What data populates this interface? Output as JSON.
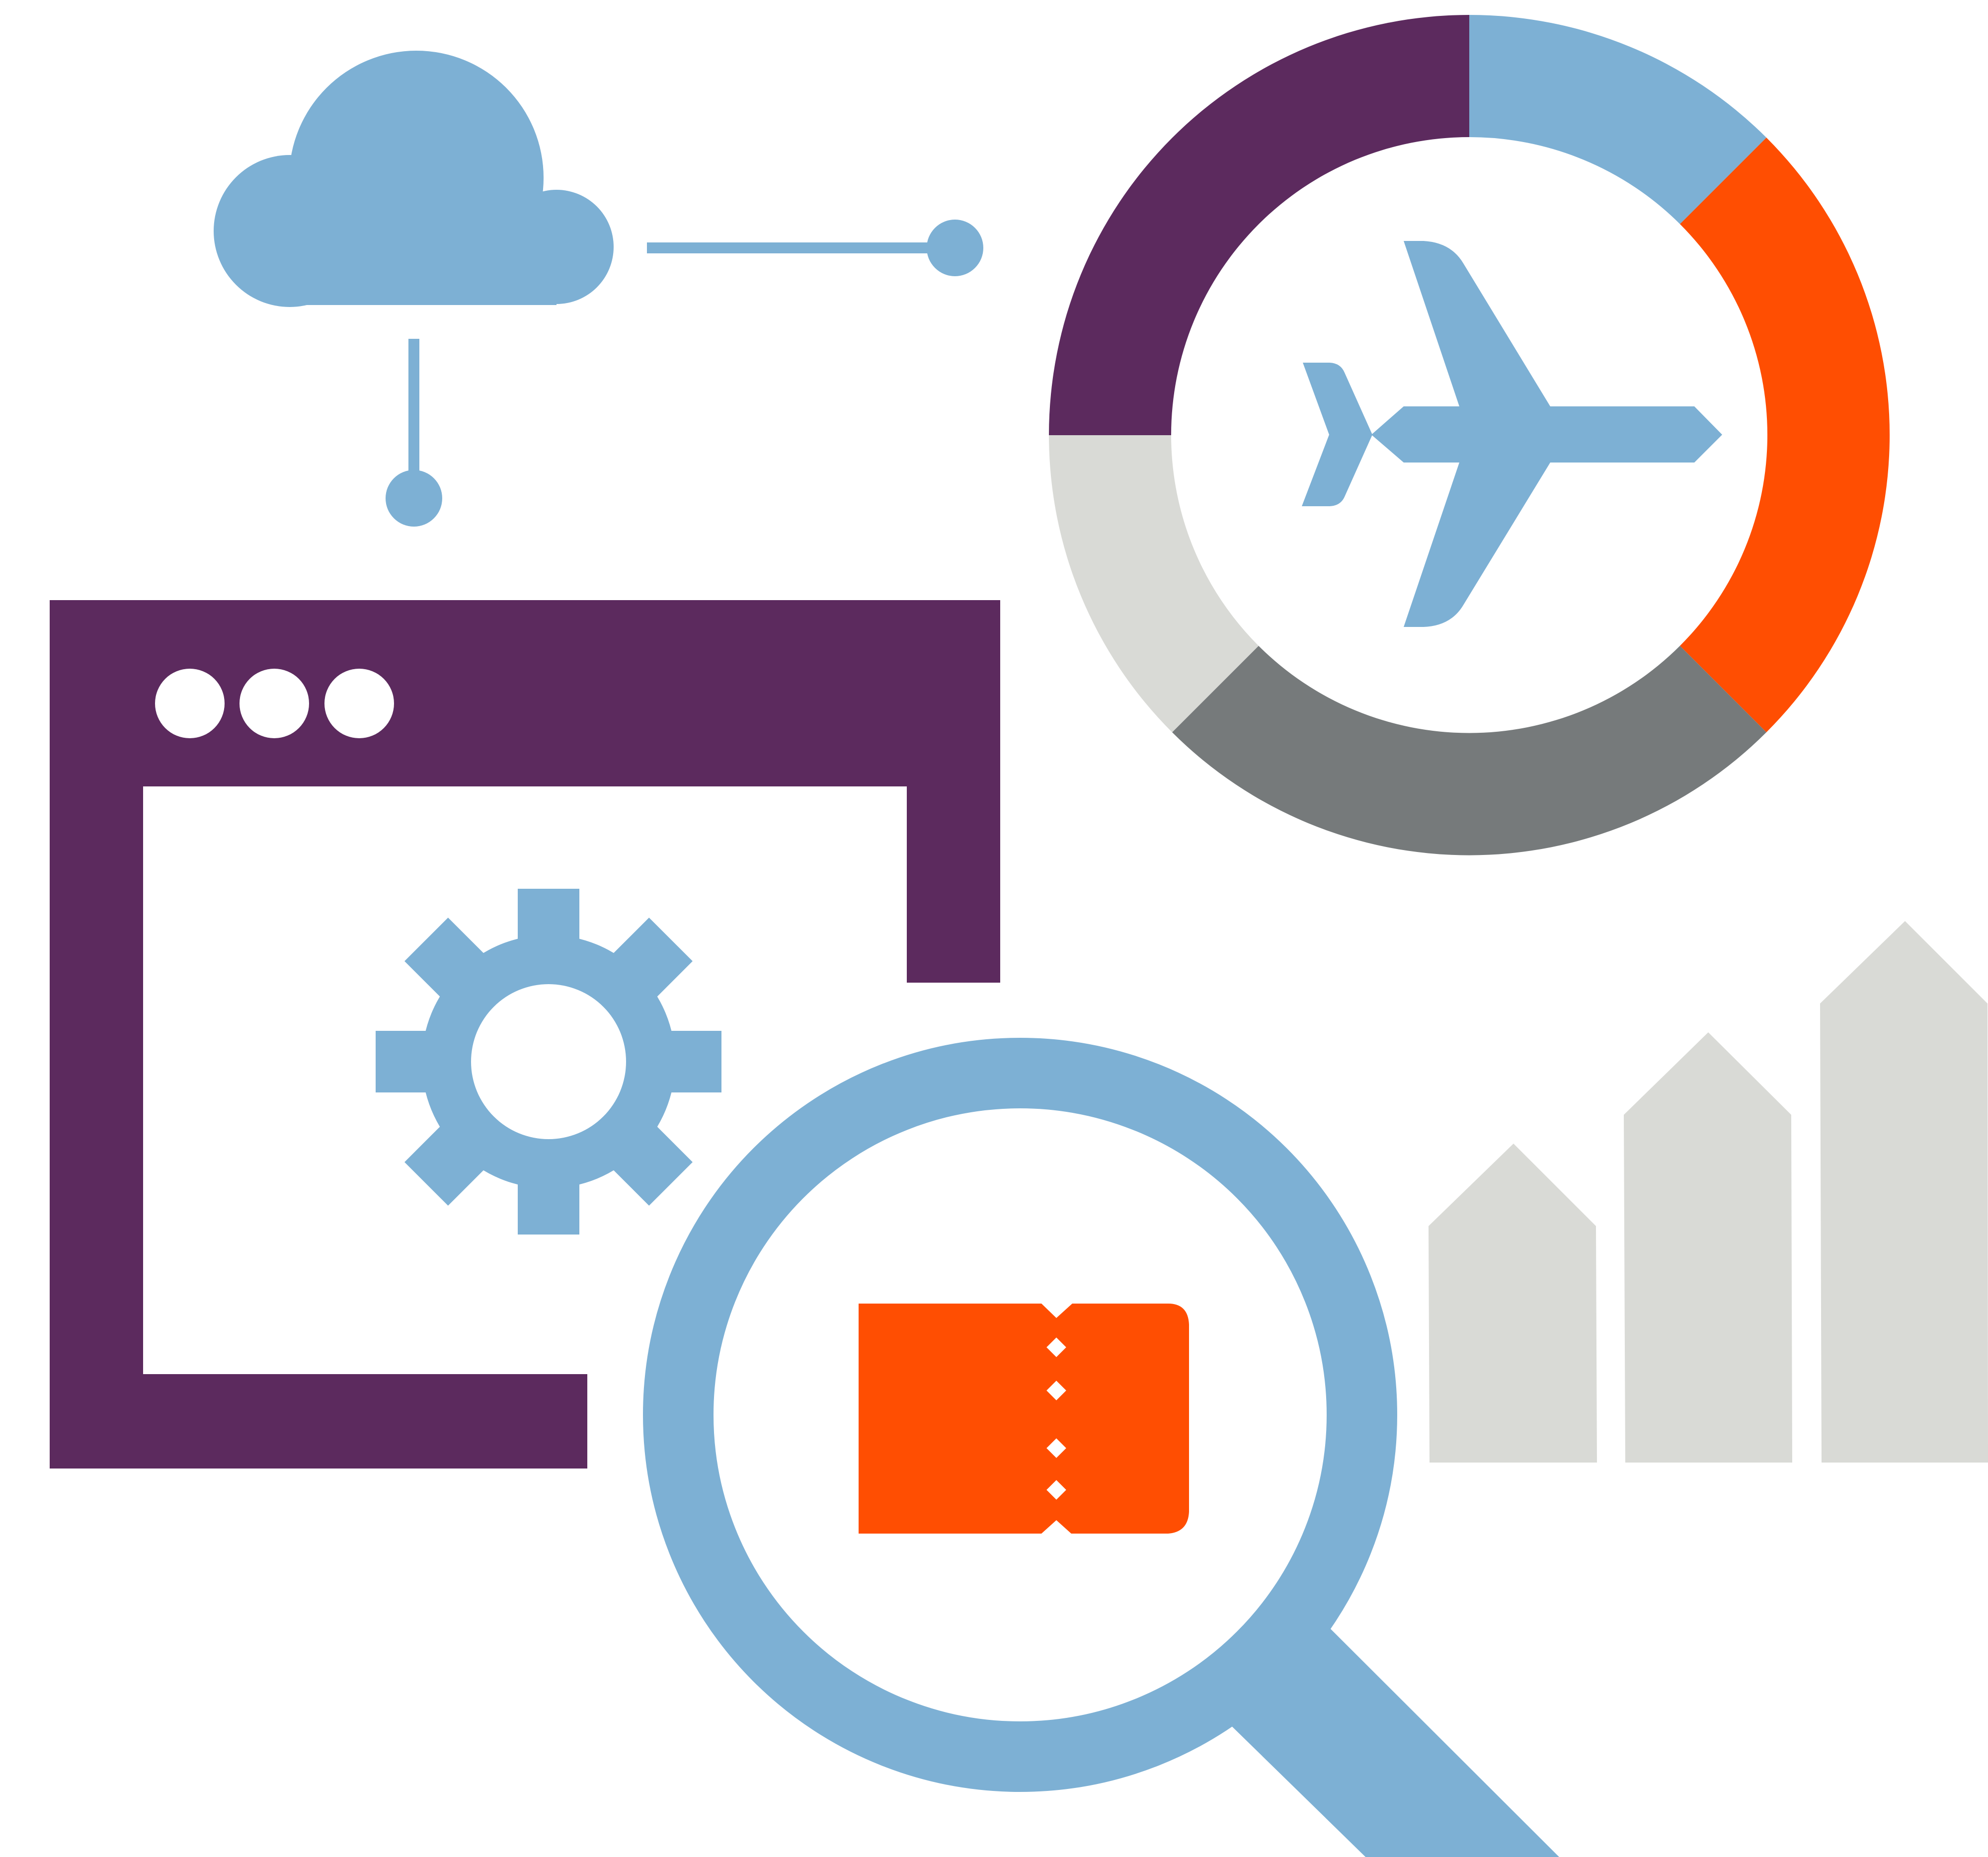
{
  "colors": {
    "blue": "#7db0d4",
    "purple": "#5c2a5e",
    "orange": "#ff4e02",
    "light_gray": "#d9dad6",
    "dark_gray": "#767a7b",
    "white": "#ffffff"
  },
  "icons": {
    "cloud": "cloud-icon",
    "plane": "airplane-icon",
    "gear": "gear-icon",
    "magnifier": "magnifying-glass-icon",
    "ticket": "ticket-icon",
    "browser": "browser-window-icon",
    "donut": "donut-ring",
    "bars": "bar-chart-arrows"
  },
  "donut_segments": [
    {
      "name": "purple",
      "color": "#5c2a5e",
      "fraction": 0.25
    },
    {
      "name": "blue",
      "color": "#7db0d4",
      "fraction": 0.125
    },
    {
      "name": "orange",
      "color": "#ff4e02",
      "fraction": 0.25
    },
    {
      "name": "dark-gray",
      "color": "#767a7b",
      "fraction": 0.25
    },
    {
      "name": "light-gray",
      "color": "#d9dad6",
      "fraction": 0.125
    }
  ]
}
